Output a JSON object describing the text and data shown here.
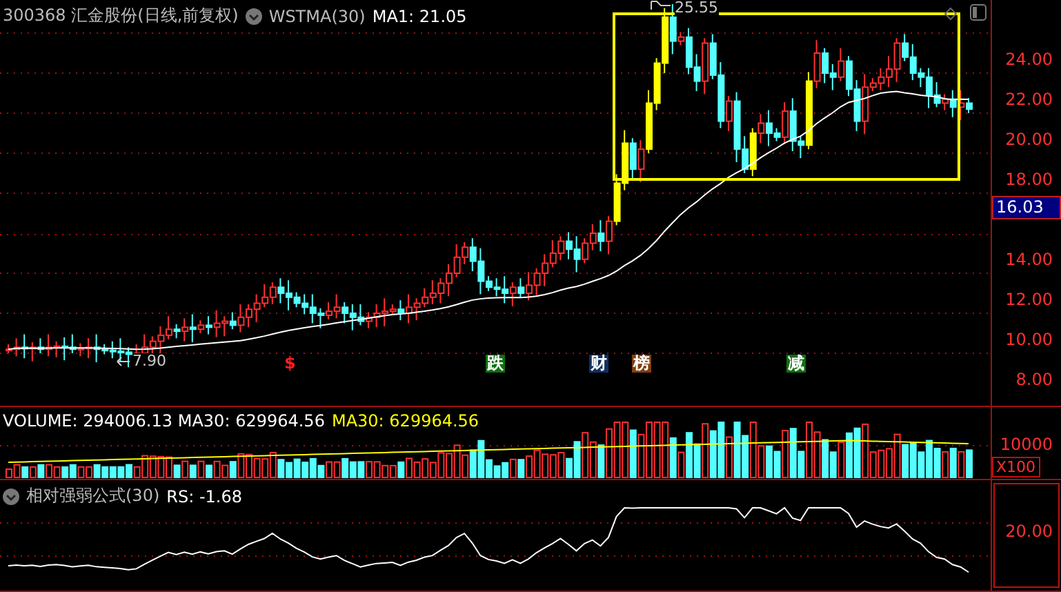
{
  "header": {
    "code": "300368",
    "name": "汇金股份",
    "period": "(日线,前复权)",
    "indicator": "WSTMA(30)",
    "ma_label": "MA1:",
    "ma_value": "21.05"
  },
  "price_axis": {
    "ticks": [
      "24.00",
      "22.00",
      "20.00",
      "18.00",
      "14.00",
      "12.00",
      "10.00",
      "8.00"
    ],
    "current": "16.03"
  },
  "annotations": {
    "high": "25.55",
    "low": "7.90"
  },
  "markers": [
    {
      "label": "$",
      "color": "#ff2020",
      "kind": "plain"
    },
    {
      "label": "跌",
      "color": "#107010",
      "kind": "boxed"
    },
    {
      "label": "财",
      "color": "#103060",
      "kind": "boxed"
    },
    {
      "label": "榜",
      "color": "#804010",
      "kind": "boxed"
    },
    {
      "label": "减",
      "color": "#107010",
      "kind": "boxed"
    }
  ],
  "volume": {
    "label": "VOLUME:",
    "value": "294006.13",
    "ma_label": "MA30:",
    "ma_value": "629964.56",
    "ma_label_2": "MA30:",
    "ma_value_2": "629964.56",
    "axis_label": "10000",
    "unit": "X100"
  },
  "rs": {
    "title": "相对强弱公式(30)",
    "label": "RS:",
    "value": "-1.68",
    "axis_label": "20.00"
  }
}
